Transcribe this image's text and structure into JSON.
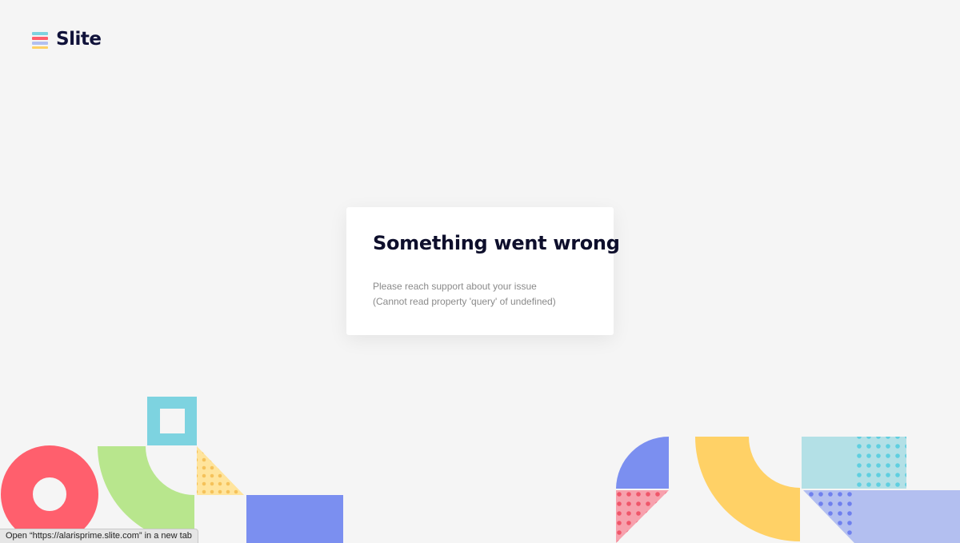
{
  "brand": {
    "name": "Slite"
  },
  "error": {
    "title": "Something went wrong",
    "message_line1": "Please reach support about your issue",
    "message_line2": "(Cannot read property 'query' of undefined)"
  },
  "status_bar": {
    "text": "Open “https://alarisprime.slite.com” in a new tab"
  },
  "colors": {
    "background": "#f5f5f5",
    "coral": "#ff5f6d",
    "green": "#b8e68d",
    "cyan": "#7dd3e0",
    "yellow": "#ffd166",
    "blue": "#7b8ff0",
    "pink": "#f7a1ad",
    "light_cyan": "#b3e0e6",
    "light_blue": "#b3bff0"
  },
  "icons": {
    "logo": "slite-logo-icon"
  }
}
